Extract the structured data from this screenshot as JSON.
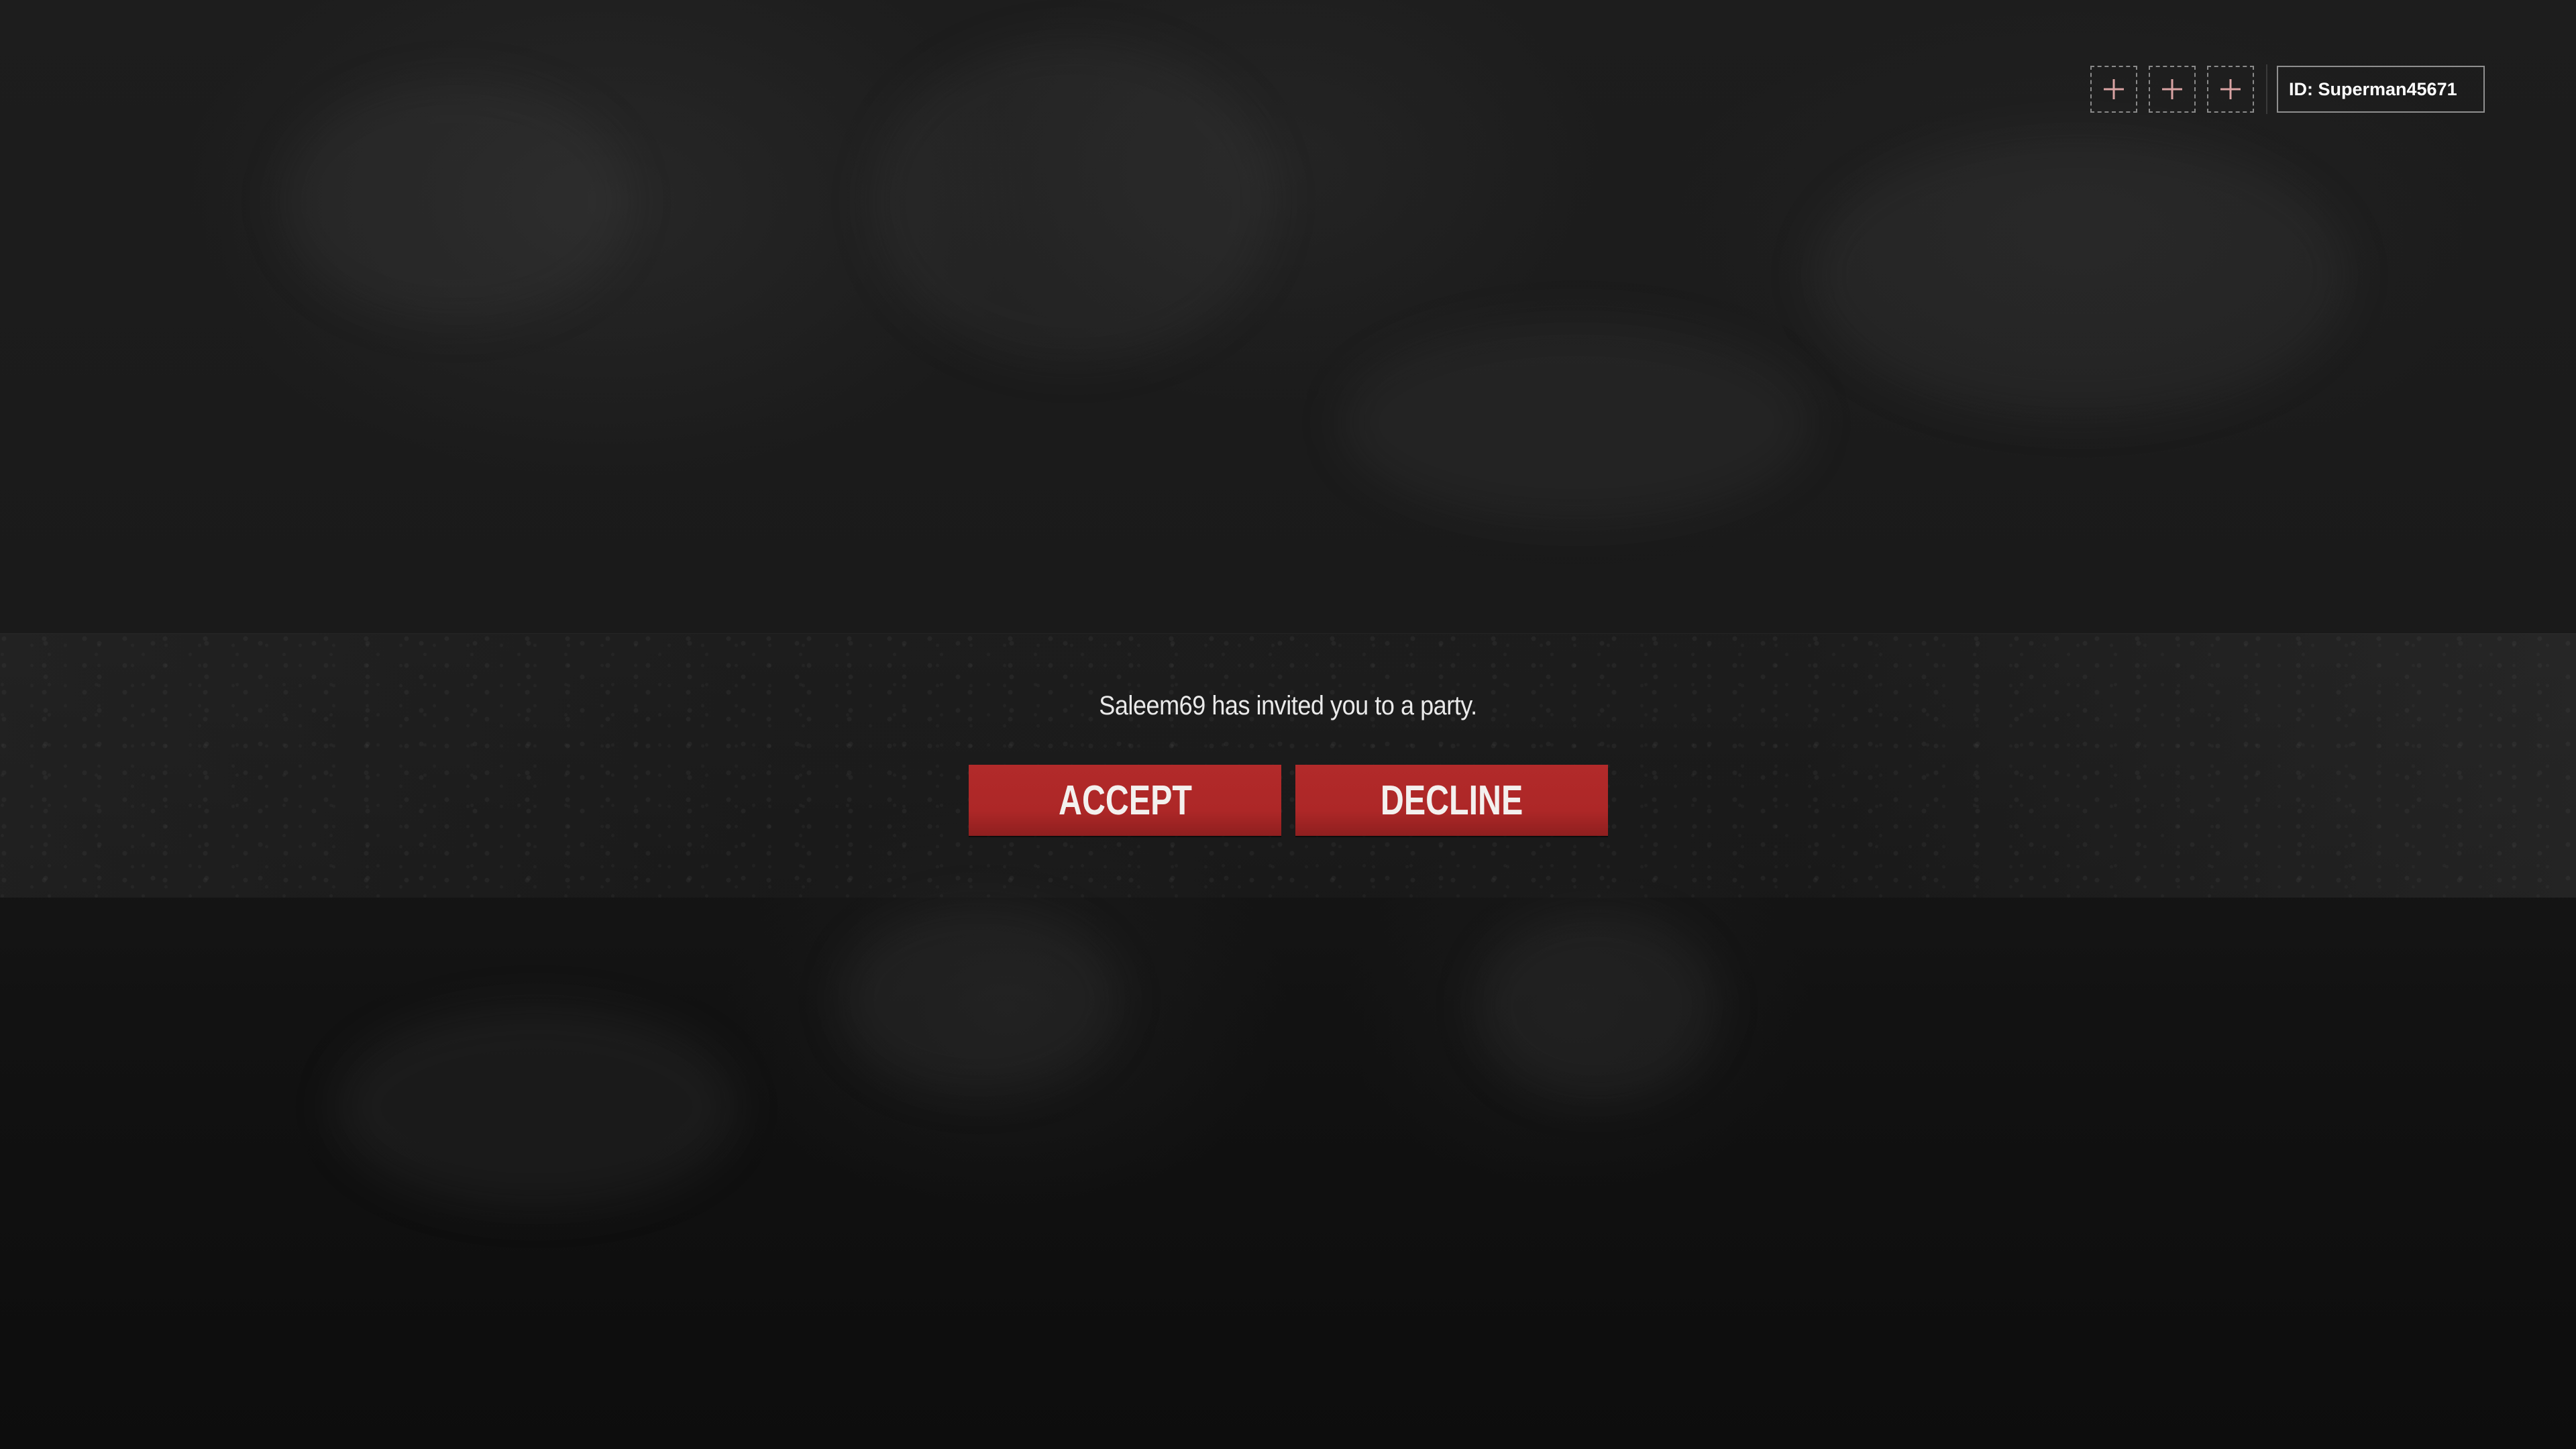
{
  "invite": {
    "message": "Saleem69 has invited you to a party.",
    "accept_label": "ACCEPT",
    "decline_label": "DECLINE"
  },
  "party_slots": [
    {
      "icon": "plus-icon"
    },
    {
      "icon": "plus-icon"
    },
    {
      "icon": "plus-icon"
    }
  ],
  "player": {
    "id_label": "ID: Superman45671"
  },
  "colors": {
    "button_red": "#b22a2a",
    "plus_icon": "#d9a3a3",
    "background": "#161616"
  }
}
